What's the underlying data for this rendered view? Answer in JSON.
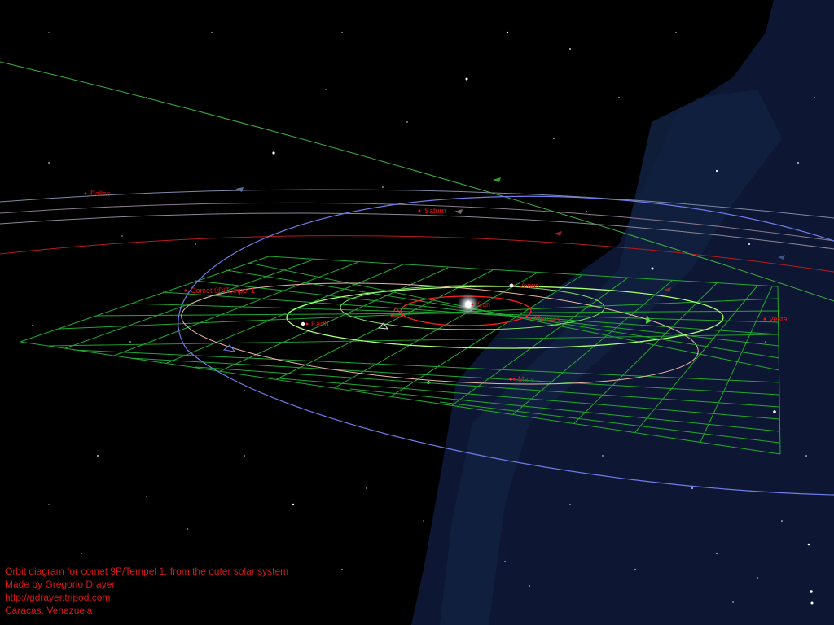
{
  "labels": {
    "pallas": "Pallas",
    "saturn": "Saturn",
    "comet": "Comet 9P/Tempel 1",
    "venus": "Venus",
    "sun": "Sun",
    "mercury": "Mercury",
    "earth": "Earth",
    "vesta": "Vesta",
    "mars": "Mars"
  },
  "caption": {
    "line1": "Orbit diagram for comet 9P/Tempel 1, from the outer solar system",
    "line2": "Made by Gregorio Drayer",
    "line3": "http://gdrayer.tripod.com",
    "line4": "Caracas, Venezuela"
  },
  "colors": {
    "background": "#000000",
    "milky_way": "#101c3a",
    "grid": "#20b030",
    "label": "#e01818",
    "comet_orbit": "#7080e8",
    "earth_orbit": "#a8ff70",
    "mars_orbit": "#f0b8a0",
    "mercury_orbit": "#ff2020",
    "sun": "#ffffff"
  }
}
